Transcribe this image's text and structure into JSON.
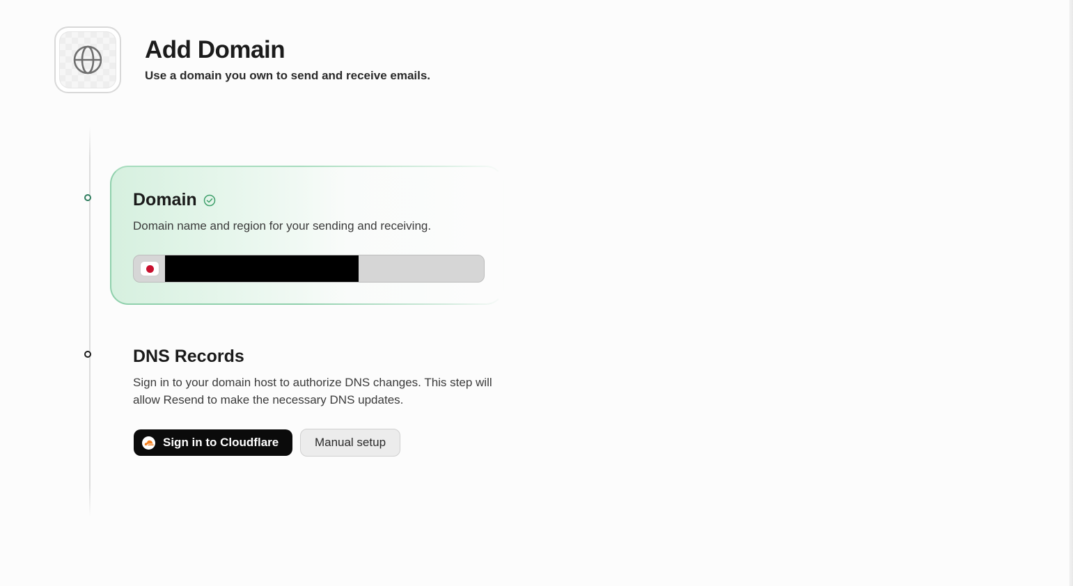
{
  "header": {
    "icon": "globe-icon",
    "title": "Add Domain",
    "subtitle": "Use a domain you own to send and receive emails."
  },
  "steps": {
    "domain": {
      "title": "Domain",
      "status_icon": "check-circle-icon",
      "description": "Domain name and region for your sending and receiving.",
      "region_icon": "japan-flag-icon",
      "value": ""
    },
    "dns": {
      "title": "DNS Records",
      "description": "Sign in to your domain host to authorize DNS changes. This step will allow Resend to make the necessary DNS updates.",
      "primary_button": "Sign in to Cloudflare",
      "primary_icon": "cloudflare-icon",
      "secondary_button": "Manual setup"
    }
  },
  "colors": {
    "accent_green": "#8fd0ac",
    "step_active": "#2f7d5e",
    "primary_button_bg": "#0b0b0b",
    "cloudflare_orange": "#f38020"
  }
}
